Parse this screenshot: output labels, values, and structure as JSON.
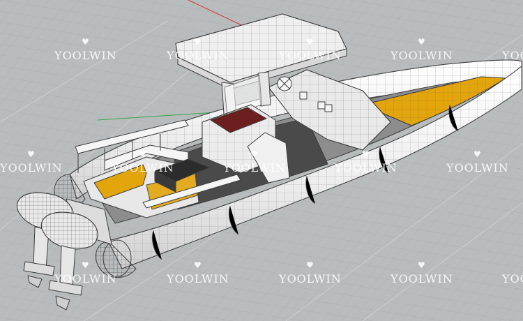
{
  "watermark": {
    "text": "YOOLWIN",
    "icon": "heart-icon",
    "color": "#ffffff"
  },
  "viewport": {
    "background": "#b9bcbd",
    "grid_color": "#a9acae",
    "x_axis_color": "#d23b3b",
    "y_axis_color": "#3aa54a"
  },
  "model": {
    "hull_color": "#f2f2f2",
    "wire_color": "#3d3d3d",
    "deck_color": "#4a4a4a",
    "accent_color": "#e3a50c",
    "seat_color": "#6b1f1f",
    "engine_color": "#e9e9e9"
  }
}
